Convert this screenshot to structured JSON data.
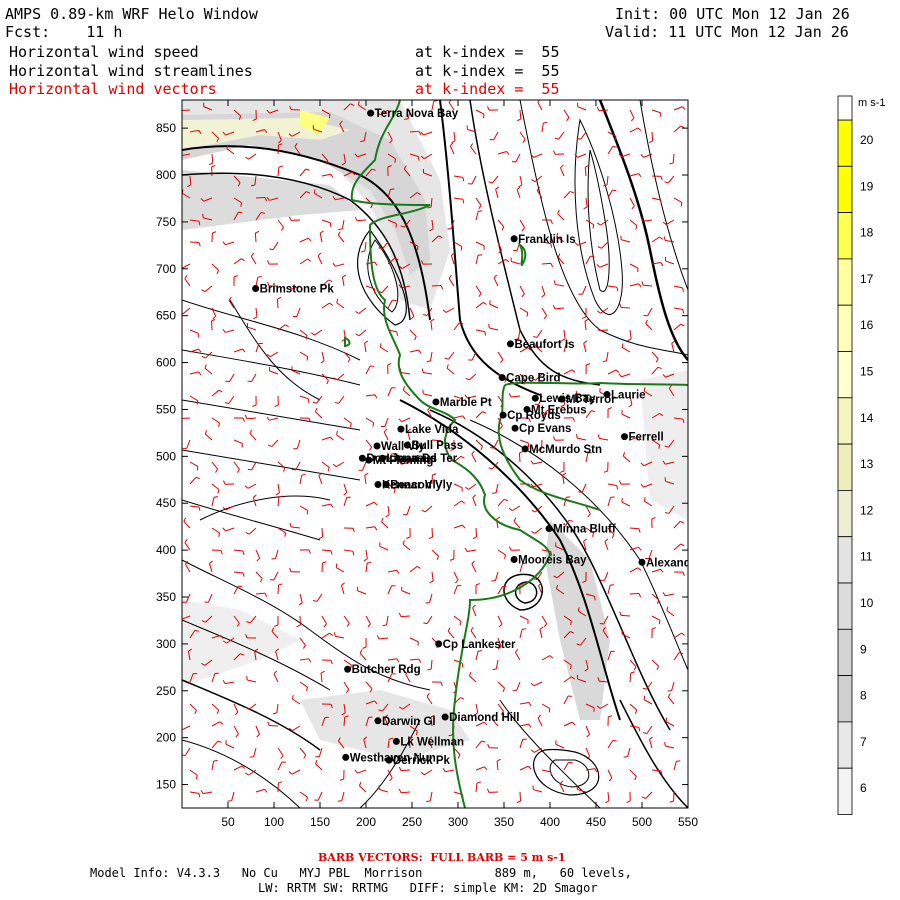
{
  "header": {
    "title": "AMPS 0.89-km WRF Helo Window",
    "fcst_label": "Fcst:",
    "fcst_value": "11 h",
    "init": "Init: 00 UTC Mon 12 Jan 26",
    "valid": "Valid: 11 UTC Mon 12 Jan 26",
    "fields": [
      {
        "name": "Horizontal wind speed",
        "level": "at k-index =  55",
        "color": "#000000"
      },
      {
        "name": "Horizontal wind streamlines",
        "level": "at k-index =  55",
        "color": "#000000"
      },
      {
        "name": "Horizontal wind vectors",
        "level": "at k-index =  55",
        "color": "#e00000"
      }
    ]
  },
  "map": {
    "x_ticks": [
      "50",
      "100",
      "150",
      "200",
      "250",
      "300",
      "350",
      "400",
      "450",
      "500",
      "550"
    ],
    "y_ticks": [
      "850",
      "800",
      "750",
      "700",
      "650",
      "600",
      "550",
      "500",
      "450",
      "400",
      "350",
      "300",
      "250",
      "200",
      "150"
    ],
    "places": [
      {
        "name": "Terra Nova Bay",
        "x": 205,
        "y": 866
      },
      {
        "name": "Franklin Is",
        "x": 361,
        "y": 732
      },
      {
        "name": "Brimstone Pk",
        "x": 80,
        "y": 679
      },
      {
        "name": "Beaufort Is",
        "x": 357,
        "y": 620
      },
      {
        "name": "Cape Bird",
        "x": 348,
        "y": 584
      },
      {
        "name": "Lewis Bay",
        "x": 384,
        "y": 562
      },
      {
        "name": "Mt Terror",
        "x": 413,
        "y": 561
      },
      {
        "name": "Laurie",
        "x": 462,
        "y": 566
      },
      {
        "name": "Marble Pt",
        "x": 276,
        "y": 558
      },
      {
        "name": "Cp Royds",
        "x": 349,
        "y": 544
      },
      {
        "name": "Mt Erebus",
        "x": 375,
        "y": 550
      },
      {
        "name": "Lake Vida",
        "x": 238,
        "y": 529
      },
      {
        "name": "Cp Evans",
        "x": 362,
        "y": 530
      },
      {
        "name": "Ferrell",
        "x": 481,
        "y": 521
      },
      {
        "name": "Wall Vly",
        "x": 212,
        "y": 511
      },
      {
        "name": "Bull Pass",
        "x": 245,
        "y": 512
      },
      {
        "name": "McMurdo Stn",
        "x": 373,
        "y": 508
      },
      {
        "name": "Don Juan Pd",
        "x": 196,
        "y": 498
      },
      {
        "name": "Mt Fleming",
        "x": 203,
        "y": 496
      },
      {
        "name": "Linnaeus Ter",
        "x": 218,
        "y": 498
      },
      {
        "name": "Kennar Vly",
        "x": 213,
        "y": 470
      },
      {
        "name": "Beacon Vly",
        "x": 222,
        "y": 470
      },
      {
        "name": "Minna Bluff",
        "x": 399,
        "y": 423
      },
      {
        "name": "Mooreis Bay",
        "x": 361,
        "y": 390
      },
      {
        "name": "Alexander",
        "x": 500,
        "y": 387
      },
      {
        "name": "Cp Lankester",
        "x": 279,
        "y": 300
      },
      {
        "name": "Butcher Rdg",
        "x": 180,
        "y": 273
      },
      {
        "name": "Darwin Gl",
        "x": 213,
        "y": 218
      },
      {
        "name": "Diamond Hill",
        "x": 286,
        "y": 222
      },
      {
        "name": "Lk Wellman",
        "x": 233,
        "y": 196
      },
      {
        "name": "Westhaven Nun",
        "x": 178,
        "y": 179
      },
      {
        "name": "Derrick Pk",
        "x": 225,
        "y": 176
      }
    ]
  },
  "legend": {
    "units": "m s-1",
    "labels": [
      "20",
      "19",
      "18",
      "17",
      "16",
      "15",
      "14",
      "13",
      "12",
      "11",
      "10",
      "9",
      "8",
      "7",
      "6"
    ],
    "colors": [
      "#ffff00",
      "#ffff00",
      "#ffff50",
      "#ffffa0",
      "#ffffb8",
      "#ffffd0",
      "#f5f5c0",
      "#eeeebb",
      "#eeeed4",
      "#e3e3e3",
      "#dcdcdc",
      "#d4d4d4",
      "#cfcfcf",
      "#e8e8e8",
      "#f4f4f4"
    ]
  },
  "footer": {
    "barb_note": "BARB VECTORS:  FULL BARB = 5 m s-1",
    "model_info": "Model Info: V4.3.3   No Cu   MYJ PBL  Morrison          889 m,   60 levels,",
    "schemes": "LW: RRTM SW: RRTMG   DIFF: simple KM: 2D Smagor"
  }
}
